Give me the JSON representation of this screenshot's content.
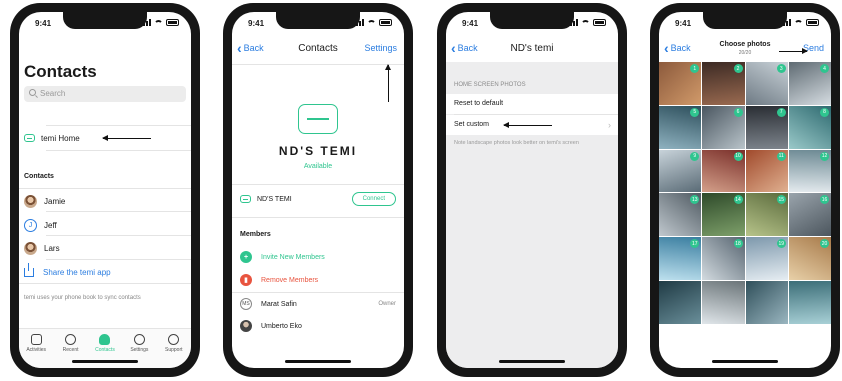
{
  "status": {
    "time": "9:41"
  },
  "colors": {
    "accent_green": "#2fc58f",
    "link_blue": "#2b7de0",
    "danger_red": "#e8543f"
  },
  "phone1": {
    "title": "Contacts",
    "search_placeholder": "Search",
    "home_item": "temi Home",
    "contacts_header": "Contacts",
    "contacts": [
      {
        "name": "Jamie",
        "avatar": "photo"
      },
      {
        "name": "Jeff",
        "avatar": "J"
      },
      {
        "name": "Lars",
        "avatar": "photo"
      }
    ],
    "share": "Share the temi app",
    "note": "temi uses your phone book to sync contacts",
    "tabs": [
      {
        "label": "Activities",
        "icon": "activities-icon"
      },
      {
        "label": "Recent",
        "icon": "clock-icon"
      },
      {
        "label": "Contacts",
        "icon": "person-icon",
        "active": true
      },
      {
        "label": "Settings",
        "icon": "gear-icon"
      },
      {
        "label": "Support",
        "icon": "chat-icon"
      }
    ]
  },
  "phone2": {
    "back": "Back",
    "title": "Contacts",
    "action": "Settings",
    "robot_name": "ND'S TEMI",
    "status": "Available",
    "robot_item": "ND'S TEMI",
    "connect": "Connect",
    "members_header": "Members",
    "invite": "Invite New Members",
    "remove": "Remove Members",
    "members": [
      {
        "initials": "MS",
        "name": "Marat Safin",
        "role": "Owner"
      },
      {
        "initials": "",
        "name": "Umberto Eko",
        "role": ""
      }
    ]
  },
  "phone3": {
    "back": "Back",
    "title": "ND's temi",
    "section": "HOME SCREEN PHOTOS",
    "rows": [
      "Reset to default",
      "Set custom"
    ],
    "note": "Note landscape photos look better on temi's screen"
  },
  "phone4": {
    "back": "Back",
    "title": "Choose photos",
    "count": "20/20",
    "action": "Send",
    "selected_numbers": [
      "1",
      "2",
      "3",
      "4",
      "5",
      "6",
      "7",
      "8",
      "9",
      "10",
      "11",
      "12",
      "13",
      "14",
      "15",
      "16",
      "17",
      "18",
      "19",
      "20"
    ]
  }
}
